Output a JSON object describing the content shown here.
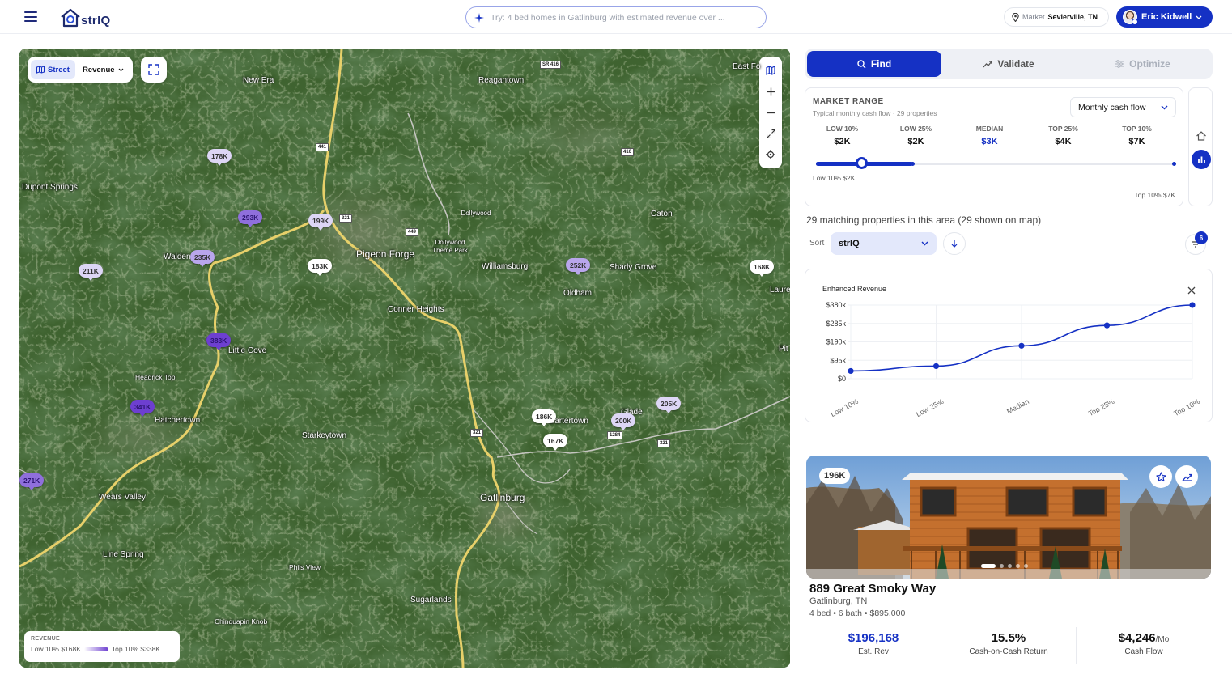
{
  "app": {
    "logo_text": "strIQ"
  },
  "search": {
    "placeholder": "Try: 4 bed homes in Gatlinburg with estimated revenue over ..."
  },
  "market": {
    "label": "Market",
    "value": "Sevierville, TN"
  },
  "user": {
    "name": "Eric Kidwell"
  },
  "map": {
    "view_label": "Street",
    "layer_label": "Revenue",
    "places": [
      {
        "name": "New Era",
        "style": "town"
      },
      {
        "name": "Reagantown",
        "style": "town"
      },
      {
        "name": "Dupont Springs",
        "style": "town"
      },
      {
        "name": "Dollywood",
        "style": "poi"
      },
      {
        "name": "Dollywood Theme Park",
        "style": "poi"
      },
      {
        "name": "Caton",
        "style": "town"
      },
      {
        "name": "Pigeon Forge",
        "style": "city"
      },
      {
        "name": "Walden Creek",
        "style": "town"
      },
      {
        "name": "Williamsburg",
        "style": "town"
      },
      {
        "name": "Shady Grove",
        "style": "town"
      },
      {
        "name": "Oldham",
        "style": "town"
      },
      {
        "name": "Conner Heights",
        "style": "town"
      },
      {
        "name": "Little Cove",
        "style": "town"
      },
      {
        "name": "Headrick Top",
        "style": "peak"
      },
      {
        "name": "Hatchertown",
        "style": "town"
      },
      {
        "name": "Starkeytown",
        "style": "town"
      },
      {
        "name": "Cartertown",
        "style": "town"
      },
      {
        "name": "Glade",
        "style": "town"
      },
      {
        "name": "Wears Valley",
        "style": "town"
      },
      {
        "name": "Gatlinburg",
        "style": "city"
      },
      {
        "name": "Line Spring",
        "style": "town"
      },
      {
        "name": "Phils View",
        "style": "peak"
      },
      {
        "name": "Sugarlands",
        "style": "town"
      },
      {
        "name": "Chinquapin Knob",
        "style": "peak"
      },
      {
        "name": "East Fo",
        "style": "town"
      },
      {
        "name": "Laure",
        "style": "town"
      },
      {
        "name": "Pit",
        "style": "town"
      }
    ],
    "road_shields": [
      "SR 416",
      "441",
      "416",
      "321",
      "449",
      "321",
      "1284",
      "321"
    ],
    "markers": [
      {
        "label": "178K",
        "tier": 1
      },
      {
        "label": "293K",
        "tier": 3
      },
      {
        "label": "199K",
        "tier": 1
      },
      {
        "label": "211K",
        "tier": 1
      },
      {
        "label": "235K",
        "tier": 2
      },
      {
        "label": "183K",
        "tier": 0
      },
      {
        "label": "252K",
        "tier": 2
      },
      {
        "label": "168K",
        "tier": 0
      },
      {
        "label": "383K",
        "tier": 4
      },
      {
        "label": "341K",
        "tier": 4
      },
      {
        "label": "186K",
        "tier": 0
      },
      {
        "label": "205K",
        "tier": 1
      },
      {
        "label": "200K",
        "tier": 1
      },
      {
        "label": "167K",
        "tier": 0
      },
      {
        "label": "271K",
        "tier": 3
      }
    ],
    "legend": {
      "title": "REVENUE",
      "low": "Low 10% $168K",
      "high": "Top 10% $338K"
    }
  },
  "tabs": [
    {
      "label": "Find",
      "state": "active"
    },
    {
      "label": "Validate",
      "state": "normal"
    },
    {
      "label": "Optimize",
      "state": "disabled"
    }
  ],
  "market_range": {
    "title": "MARKET RANGE",
    "subtitle": "Typical monthly cash flow · 29 properties",
    "metric_select": "Monthly cash flow",
    "columns": [
      {
        "label": "LOW 10%",
        "value": "$2K"
      },
      {
        "label": "LOW 25%",
        "value": "$2K"
      },
      {
        "label": "MEDIAN",
        "value": "$3K"
      },
      {
        "label": "TOP 25%",
        "value": "$4K"
      },
      {
        "label": "TOP 10%",
        "value": "$7K"
      }
    ],
    "low_caption": "Low 10% $2K",
    "high_caption": "Top 10% $7K"
  },
  "results": {
    "matching_text": "29 matching properties in this area (29 shown on map)",
    "sort_label": "Sort",
    "sort_value": "strIQ",
    "filter_count": "6"
  },
  "chart_data": {
    "type": "line",
    "title": "Enhanced Revenue",
    "categories": [
      "Low 10%",
      "Low 25%",
      "Median",
      "Top 25%",
      "Top 10%"
    ],
    "values": [
      40000,
      65000,
      170000,
      275000,
      380000
    ],
    "yticks": [
      "$0",
      "$95k",
      "$190k",
      "$285k",
      "$380k"
    ],
    "ylim": [
      0,
      380000
    ],
    "color": "#1531c4",
    "grid": true
  },
  "property": {
    "price_tag": "196K",
    "address": "889 Great Smoky Way",
    "city": "Gatlinburg, TN",
    "specs": "4 bed • 6 bath • $895,000",
    "stats": [
      {
        "value": "$196,168",
        "suffix": "",
        "label": "Est. Rev"
      },
      {
        "value": "15.5%",
        "suffix": "",
        "label": "Cash-on-Cash Return"
      },
      {
        "value": "$4,246",
        "suffix": "/Mo",
        "label": "Cash Flow"
      }
    ],
    "photo_count": 5
  },
  "colors": {
    "accent": "#1531c4",
    "marker_tiers": [
      "#ffffff",
      "#ddd6f5",
      "#b9a6ec",
      "#8f6fdc",
      "#6d3fd0"
    ]
  }
}
